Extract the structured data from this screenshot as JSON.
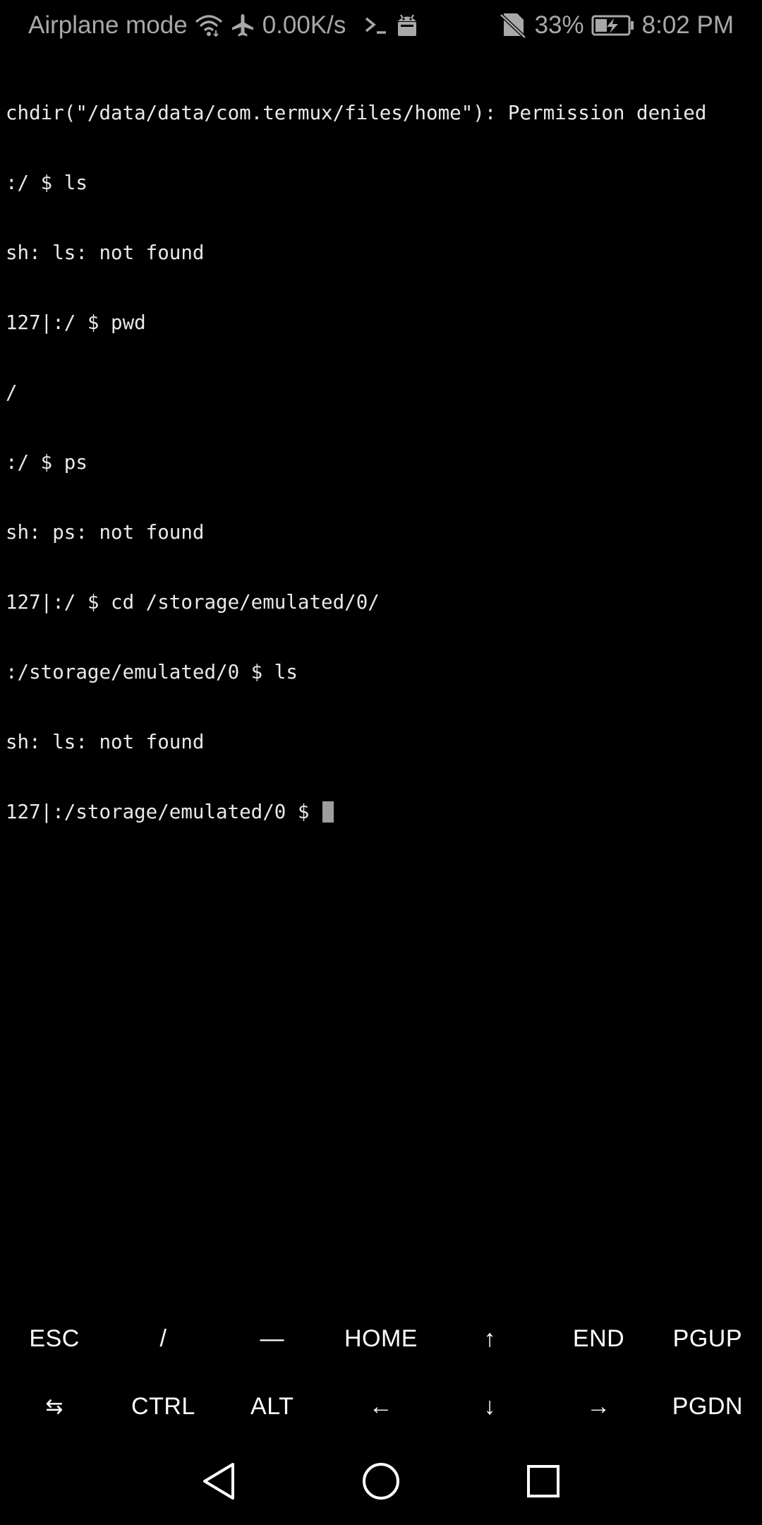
{
  "status_bar": {
    "mode_text": "Airplane mode",
    "speed": "0.00K/s",
    "battery": "33%",
    "time": "8:02 PM",
    "icons": [
      "wifi-icon",
      "airplane-icon",
      "terminal-icon",
      "android-icon",
      "no-sim-icon",
      "battery-charging-icon"
    ]
  },
  "terminal": {
    "lines": [
      "chdir(\"/data/data/com.termux/files/home\"): Permission denied",
      ":/ $ ls",
      "sh: ls: not found",
      "127|:/ $ pwd",
      "/",
      ":/ $ ps",
      "sh: ps: not found",
      "127|:/ $ cd /storage/emulated/0/",
      ":/storage/emulated/0 $ ls",
      "sh: ls: not found",
      "127|:/storage/emulated/0 $ "
    ]
  },
  "extra_keys": {
    "row1": [
      "ESC",
      "/",
      "—",
      "HOME",
      "↑",
      "END",
      "PGUP"
    ],
    "row2": [
      "⇆",
      "CTRL",
      "ALT",
      "←",
      "↓",
      "→",
      "PGDN"
    ]
  },
  "nav_bar": {
    "icons": [
      "back-icon",
      "home-icon",
      "recents-icon"
    ]
  },
  "colors": {
    "background": "#000000",
    "status_text": "#a8a8a8",
    "terminal_text": "#e9e9e9",
    "cursor": "#9e9e9e"
  }
}
